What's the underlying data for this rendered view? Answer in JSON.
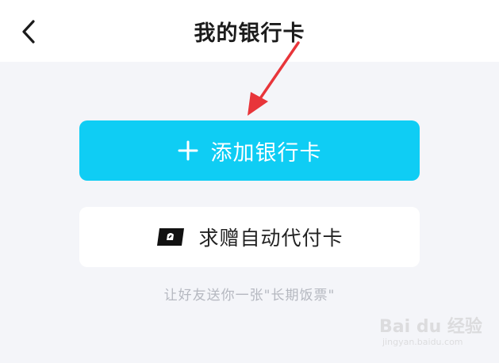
{
  "header": {
    "title": "我的银行卡",
    "back_icon": "chevron-left-icon"
  },
  "actions": {
    "add_card_label": "添加银行卡",
    "add_card_icon": "plus-icon",
    "request_card_label": "求赠自动代付卡",
    "request_card_icon": "card-icon"
  },
  "hint": "让好友送你一张\"长期饭票\"",
  "watermark": {
    "logo": "Bai du 经验",
    "url": "jingyan.baidu.com"
  },
  "colors": {
    "accent": "#0fcdf4",
    "background": "#f4f5f9",
    "annotation": "#e8353a"
  }
}
